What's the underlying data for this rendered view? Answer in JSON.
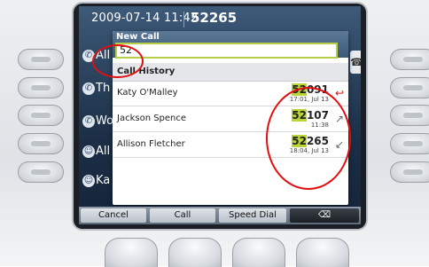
{
  "status_bar": {
    "datetime": "2009-07-14 11:42",
    "extension": "52265"
  },
  "lines": [
    {
      "label": "All",
      "icon": "phone-icon"
    },
    {
      "label": "Th",
      "icon": "phone-icon"
    },
    {
      "label": "Wo",
      "icon": "phone-icon"
    },
    {
      "label": "All",
      "icon": "contact-icon"
    },
    {
      "label": "Ka",
      "icon": "contact-icon"
    }
  ],
  "new_call": {
    "title": "New Call",
    "input_value": "52",
    "history_header": "Call History",
    "entries": [
      {
        "name": "Katy O'Malley",
        "number_match": "52",
        "number_rest": "091",
        "time": "17:01, Jul 13",
        "call_icon": "missed-call-icon"
      },
      {
        "name": "Jackson Spence",
        "number_match": "52",
        "number_rest": "107",
        "time": "11:38",
        "call_icon": "outgoing-call-icon"
      },
      {
        "name": "Allison Fletcher",
        "number_match": "52",
        "number_rest": "265",
        "time": "18:04, Jul 13",
        "call_icon": "incoming-call-icon"
      }
    ]
  },
  "softkeys": {
    "cancel": "Cancel",
    "call": "Call",
    "speed_dial": "Speed Dial",
    "backspace": "⌫"
  },
  "colors": {
    "match_highlight": "#b9d636",
    "annotation": "#e01010",
    "focus_border": "#b6cf4a"
  }
}
